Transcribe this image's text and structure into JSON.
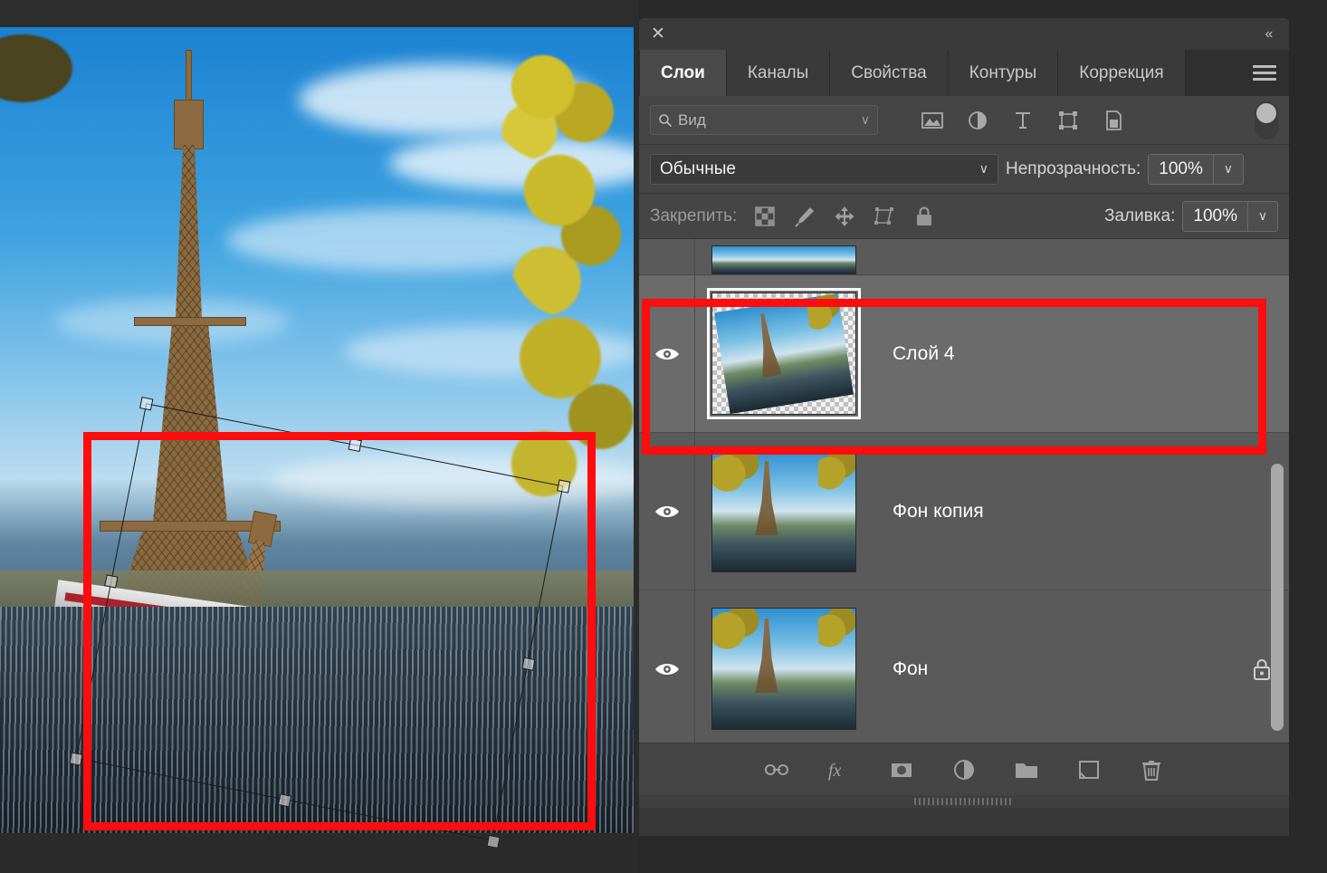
{
  "app": {
    "panel_title": "Слои",
    "close_label": "✕",
    "collapse_label": "«"
  },
  "tabs": [
    {
      "label": "Слои",
      "active": true
    },
    {
      "label": "Каналы",
      "active": false
    },
    {
      "label": "Свойства",
      "active": false
    },
    {
      "label": "Контуры",
      "active": false
    },
    {
      "label": "Коррекция",
      "active": false
    }
  ],
  "filter_row": {
    "filter_value": "Вид",
    "chevron": "∨",
    "icons": [
      {
        "name": "filter-pixel-icon"
      },
      {
        "name": "filter-adjustment-icon"
      },
      {
        "name": "filter-type-icon"
      },
      {
        "name": "filter-shape-icon"
      },
      {
        "name": "filter-smart-object-icon"
      }
    ],
    "toggle_name": "filter-enable-toggle"
  },
  "blend_row": {
    "blend_mode": "Обычные",
    "chevron": "∨",
    "opacity_label": "Непрозрачность:",
    "opacity_value": "100%",
    "stepper": "∨"
  },
  "lock_row": {
    "lock_label": "Закрепить:",
    "icons": [
      {
        "name": "lock-transparency-icon"
      },
      {
        "name": "lock-image-pixels-icon"
      },
      {
        "name": "lock-position-icon"
      },
      {
        "name": "lock-artboard-icon"
      },
      {
        "name": "lock-all-icon"
      }
    ],
    "fill_label": "Заливка:",
    "fill_value": "100%",
    "fill_stepper": "∨"
  },
  "layers": [
    {
      "name": "",
      "visible": true,
      "selected": false,
      "partial": true,
      "locked": false,
      "transparent_thumb": false
    },
    {
      "name": "Слой 4",
      "visible": true,
      "selected": true,
      "partial": false,
      "locked": false,
      "transparent_thumb": true
    },
    {
      "name": "Фон копия",
      "visible": true,
      "selected": false,
      "partial": false,
      "locked": false,
      "transparent_thumb": false
    },
    {
      "name": "Фон",
      "visible": true,
      "selected": false,
      "partial": false,
      "locked": true,
      "transparent_thumb": false
    }
  ],
  "bottom_toolbar": [
    {
      "name": "link-layers-icon",
      "label": "Связать слои"
    },
    {
      "name": "fx-layer-style-icon",
      "label": "fx"
    },
    {
      "name": "add-layer-mask-icon",
      "label": "Добавить слой-маску"
    },
    {
      "name": "new-adjustment-layer-icon",
      "label": "Новый корректирующий слой"
    },
    {
      "name": "new-group-icon",
      "label": "Создать группу"
    },
    {
      "name": "new-layer-icon",
      "label": "Создать новый слой"
    },
    {
      "name": "delete-layer-icon",
      "label": "Удалить слой"
    }
  ],
  "annotations": {
    "canvas_rect_color": "#fd0d0d",
    "layer_rect_color": "#fd0d0d"
  },
  "canvas": {
    "selection_tool": "free-transform",
    "handle_count": 8
  }
}
